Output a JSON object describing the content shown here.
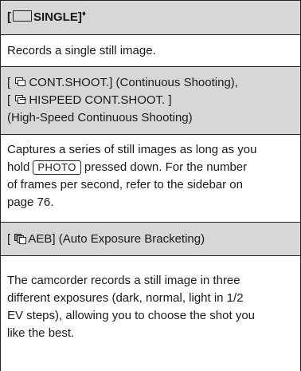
{
  "rows": {
    "single_header": {
      "open": "[",
      "label": "SINGLE]",
      "mark": "♦"
    },
    "single_body": "Records a single still image.",
    "cont_header": {
      "line1": "CONT.SHOOT.] (Continuous Shooting),",
      "line2": "HISPEED CONT.SHOOT. ]",
      "line3": "(High-Speed Continuous Shooting)"
    },
    "cont_body": {
      "line1": "Captures a series of still images as long as you",
      "line2_pre": "hold",
      "key": "PHOTO",
      "line2_post": "pressed down. For the number",
      "line3": "of frames per second, refer to the sidebar on",
      "line4": "page 76."
    },
    "aeb_header": {
      "label": "AEB] (Auto Exposure Bracketing)"
    },
    "aeb_body": {
      "line1": "The camcorder records a still image in three",
      "line2": "different exposures (dark, normal, light in 1/2",
      "line3": "EV steps), allowing you to choose the shot you",
      "line4": "like the best."
    }
  },
  "icons": [
    "single-frame-icon",
    "continuous-shoot-icon",
    "hispeed-continuous-icon",
    "auto-exposure-bracketing-icon"
  ]
}
